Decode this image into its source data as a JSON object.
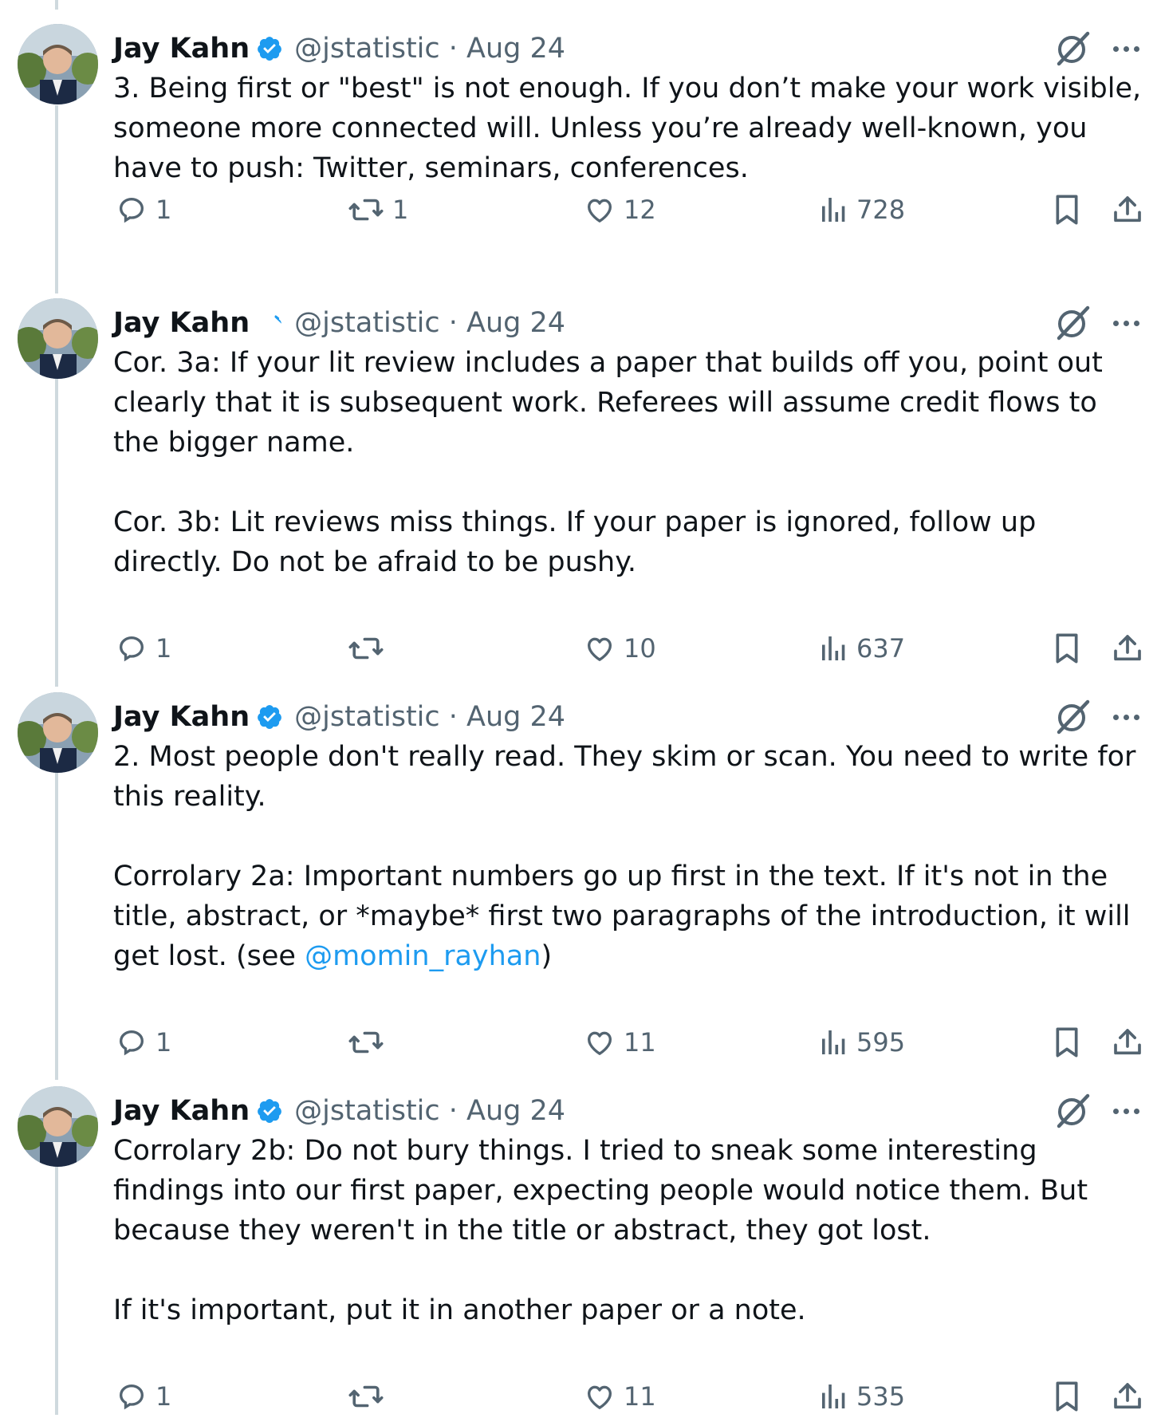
{
  "tweets": [
    {
      "author": "Jay Kahn",
      "handle": "@jstatistic",
      "date": "Aug 24",
      "paragraphs": [
        "3. Being first or \"best\" is not enough. If you don’t make your work visible, someone more connected will. Unless you’re already well-known, you have to push: Twitter, seminars, conferences."
      ],
      "stats": {
        "replies": "1",
        "reposts": "1",
        "likes": "12",
        "views": "728"
      }
    },
    {
      "author": "Jay Kahn",
      "handle": "@jstatistic",
      "date": "Aug 24",
      "paragraphs": [
        "Cor. 3a: If your lit review includes a paper that builds off you, point out clearly that it is subsequent work. Referees will assume credit flows to the bigger name.",
        "Cor. 3b: Lit reviews miss things. If your paper is ignored, follow up directly. Do not be afraid to be pushy."
      ],
      "stats": {
        "replies": "1",
        "reposts": "",
        "likes": "10",
        "views": "637"
      }
    },
    {
      "author": "Jay Kahn",
      "handle": "@jstatistic",
      "date": "Aug 24",
      "paragraphs": [
        "2. Most people don't really read. They skim or scan. You need to write for this reality.",
        "Corrolary 2a: Important numbers go up first in the text. If it's not in the title, abstract, or *maybe* first two paragraphs of the introduction, it will get lost."
      ],
      "see_prefix": "(see ",
      "mention": "@momin_rayhan",
      "see_suffix": ")",
      "stats": {
        "replies": "1",
        "reposts": "",
        "likes": "11",
        "views": "595"
      }
    },
    {
      "author": "Jay Kahn",
      "handle": "@jstatistic",
      "date": "Aug 24",
      "paragraphs": [
        "Corrolary 2b: Do not bury things. I tried to sneak some interesting findings into our first paper, expecting people would notice them. But because they weren't in the title or abstract, they got lost.",
        "If it's important, put it in another paper or a note."
      ],
      "stats": {
        "replies": "1",
        "reposts": "",
        "likes": "11",
        "views": "535"
      }
    }
  ],
  "separator": " · ",
  "colors": {
    "text": "#0f1419",
    "secondary": "#536471",
    "link": "#1d9bf0",
    "verified": "#1d9bf0",
    "thread_line": "#cfd9de"
  },
  "icons": [
    "verified-badge-icon",
    "grok-icon",
    "more-icon",
    "reply-icon",
    "repost-icon",
    "like-icon",
    "views-icon",
    "bookmark-icon",
    "share-icon"
  ]
}
